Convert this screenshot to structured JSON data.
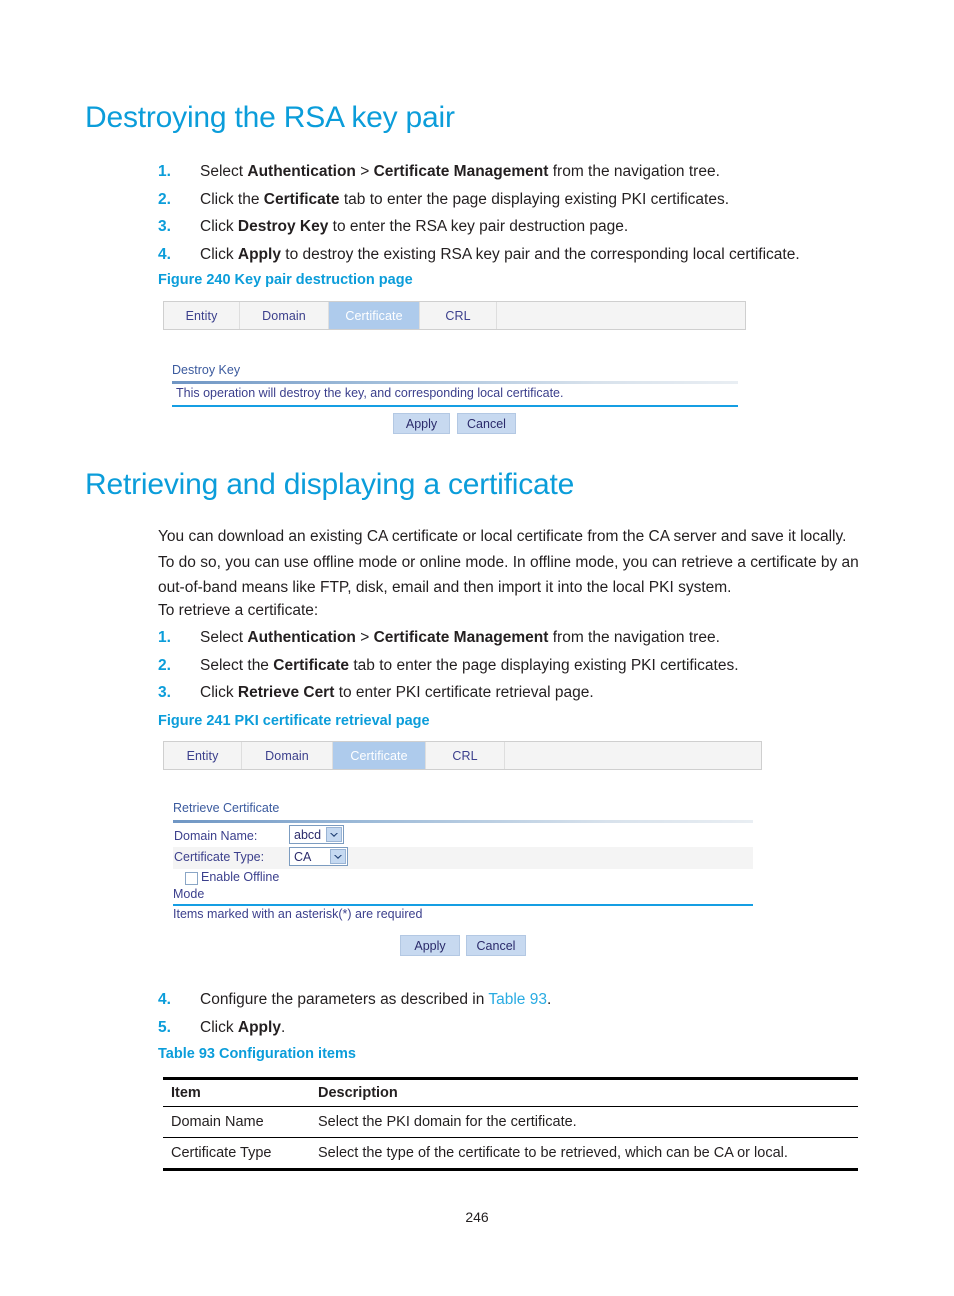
{
  "colors": {
    "heading": "#0b9dda",
    "link": "#29abe2",
    "tab_active_bg": "#aecbec",
    "ui_text": "#3b3f8c",
    "button_bg": "#c7d9f0"
  },
  "section1": {
    "heading": "Destroying the RSA key pair",
    "steps": [
      {
        "num": "1.",
        "pre": "Select ",
        "b1": "Authentication",
        "mid": " > ",
        "b2": "Certificate Management",
        "post": " from the navigation tree."
      },
      {
        "num": "2.",
        "pre": "Click the ",
        "b1": "Certificate",
        "mid": "",
        "b2": "",
        "post": " tab to enter the page displaying existing PKI certificates."
      },
      {
        "num": "3.",
        "pre": "Click ",
        "b1": "Destroy Key",
        "mid": "",
        "b2": "",
        "post": " to enter the RSA key pair destruction page."
      },
      {
        "num": "4.",
        "pre": "Click ",
        "b1": "Apply",
        "mid": "",
        "b2": "",
        "post": " to destroy the existing RSA key pair and the corresponding local certificate."
      }
    ]
  },
  "figure240": {
    "caption": "Figure 240 Key pair destruction page",
    "tabs": [
      {
        "label": "Entity",
        "active": false
      },
      {
        "label": "Domain",
        "active": false
      },
      {
        "label": "Certificate",
        "active": true
      },
      {
        "label": "CRL",
        "active": false
      }
    ],
    "section_title": "Destroy Key",
    "message": "This operation will destroy the key, and corresponding local certificate.",
    "apply_label": "Apply",
    "cancel_label": "Cancel"
  },
  "section2": {
    "heading": "Retrieving and displaying a certificate",
    "paragraph1": "You can download an existing CA certificate or local certificate from the CA server and save it locally. To do so, you can use offline mode or online mode. In offline mode, you can retrieve a certificate by an out-of-band means like FTP, disk, email and then import it into the local PKI system.",
    "paragraph2": "To retrieve a certificate:",
    "steps": [
      {
        "num": "1.",
        "pre": "Select ",
        "b1": "Authentication",
        "mid": " > ",
        "b2": "Certificate Management",
        "post": " from the navigation tree."
      },
      {
        "num": "2.",
        "pre": "Select the ",
        "b1": "Certificate",
        "mid": "",
        "b2": "",
        "post": " tab to enter the page displaying existing PKI certificates."
      },
      {
        "num": "3.",
        "pre": "Click ",
        "b1": "Retrieve Cert",
        "mid": "",
        "b2": "",
        "post": " to enter PKI certificate retrieval page."
      }
    ],
    "steps_after": [
      {
        "num": "4.",
        "pre": "Configure the parameters as described in ",
        "link": "Table 93",
        "post": "."
      },
      {
        "num": "5.",
        "pre": "Click ",
        "b1": "Apply",
        "post": "."
      }
    ]
  },
  "figure241": {
    "caption": "Figure 241 PKI certificate retrieval page",
    "tabs": [
      {
        "label": "Entity",
        "active": false
      },
      {
        "label": "Domain",
        "active": false
      },
      {
        "label": "Certificate",
        "active": true
      },
      {
        "label": "CRL",
        "active": false
      }
    ],
    "section_title": "Retrieve Certificate",
    "fields": [
      {
        "label": "Domain Name:",
        "value": "abcd"
      },
      {
        "label": "Certificate Type:",
        "value": "CA"
      }
    ],
    "checkbox_label_line1": "Enable Offline",
    "checkbox_label_line2": "Mode",
    "checkbox_checked": false,
    "required_note": "Items marked with an asterisk(*) are required",
    "apply_label": "Apply",
    "cancel_label": "Cancel"
  },
  "table93": {
    "caption": "Table 93 Configuration items",
    "headers": [
      "Item",
      "Description"
    ],
    "rows": [
      {
        "item": "Domain Name",
        "description": "Select the PKI domain for the certificate."
      },
      {
        "item": "Certificate Type",
        "description": "Select the type of the certificate to be retrieved, which can be CA or local."
      }
    ]
  },
  "footer": {
    "page_number": "246"
  }
}
